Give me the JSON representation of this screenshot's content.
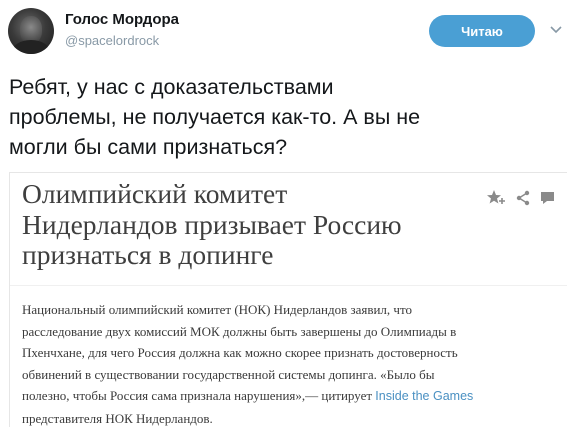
{
  "tweet": {
    "display_name": "Голос Мордора",
    "handle": "@spacelordrock",
    "follow_label": "Читаю",
    "text_lines": [
      "Ребят, у нас с доказательствами",
      "проблемы, не получается как-то. А вы не",
      "могли бы сами признаться?"
    ]
  },
  "card": {
    "title_lines": [
      "Олимпийский комитет",
      "Нидерландов призывает Россию",
      "признаться в допинге"
    ],
    "body_lines": [
      "Национальный олимпийский комитет (НОК) Нидерландов заявил, что",
      "расследование двух комиссий МОК должны быть завершены до Олимпиады в",
      "Пхенчхане, для чего Россия должна как можно скорее признать достоверность",
      "обвинений в существовании государственной системы допинга. «Было бы"
    ],
    "body_line5_before": "полезно, чтобы Россия сама признала нарушения»,— цитирует ",
    "body_link": "Inside the Games",
    "body_line6": "представителя НОК Нидерландов."
  },
  "icons": {
    "caret": "chevron-down-icon",
    "favorite": "star-plus-icon",
    "share": "share-icon",
    "comment": "comment-icon"
  },
  "colors": {
    "follow_button": "#4a9fd4",
    "link": "#4a90c2",
    "handle": "#8899a6"
  }
}
